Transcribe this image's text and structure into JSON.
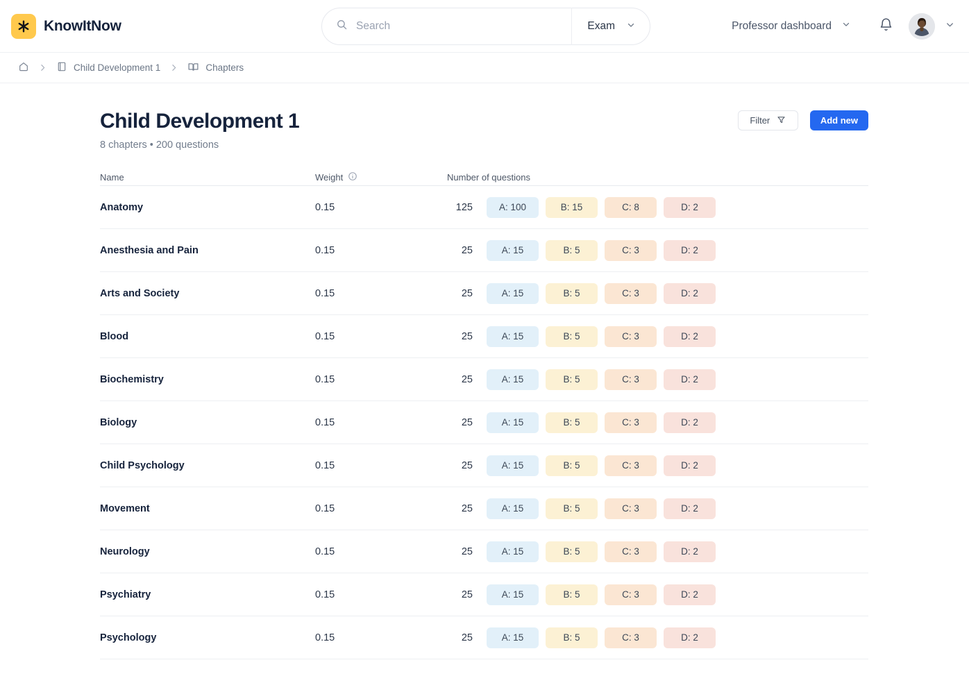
{
  "brand": {
    "name": "KnowItNow",
    "mark_icon": "asterisk-logo-icon",
    "mark_color": "#ffc94d"
  },
  "search": {
    "placeholder": "Search",
    "value": "",
    "icon": "search-icon",
    "scope_label": "Exam",
    "scope_caret_icon": "chevron-down-icon"
  },
  "header": {
    "dashboard_switcher": "Professor dashboard",
    "dashboard_caret_icon": "chevron-down-icon",
    "bell_icon": "bell-icon",
    "avatar_icon": "user-avatar",
    "avatar_caret_icon": "chevron-down-icon"
  },
  "breadcrumb": {
    "items": [
      {
        "label": "",
        "icon": "home-icon"
      },
      {
        "label": "Child Development 1",
        "icon": "book-icon"
      },
      {
        "label": "Chapters",
        "icon": "open-book-icon"
      }
    ],
    "separator_icon": "chevron-right-icon"
  },
  "page": {
    "title": "Child Development 1",
    "subtitle": "8 chapters  •  200 questions",
    "filter_label": "Filter",
    "filter_icon": "funnel-icon",
    "add_label": "Add new",
    "accent_color": "#2468f0"
  },
  "table": {
    "headers": {
      "name": "Name",
      "weight": "Weight",
      "weight_info_icon": "info-circle-icon",
      "questions": "Number of questions"
    },
    "badge_colors": {
      "A": "#e2f0f9",
      "B": "#fcf1d4",
      "C": "#fbe6d3",
      "D": "#f9e2dc"
    },
    "rows": [
      {
        "name": "Anatomy",
        "weight": "0.15",
        "total": "125",
        "badges": [
          {
            "key": "A",
            "label": "A: 100"
          },
          {
            "key": "B",
            "label": "B: 15"
          },
          {
            "key": "C",
            "label": "C: 8"
          },
          {
            "key": "D",
            "label": "D: 2"
          }
        ]
      },
      {
        "name": "Anesthesia and Pain",
        "weight": "0.15",
        "total": "25",
        "badges": [
          {
            "key": "A",
            "label": "A: 15"
          },
          {
            "key": "B",
            "label": "B: 5"
          },
          {
            "key": "C",
            "label": "C: 3"
          },
          {
            "key": "D",
            "label": "D: 2"
          }
        ]
      },
      {
        "name": "Arts and Society",
        "weight": "0.15",
        "total": "25",
        "badges": [
          {
            "key": "A",
            "label": "A: 15"
          },
          {
            "key": "B",
            "label": "B: 5"
          },
          {
            "key": "C",
            "label": "C: 3"
          },
          {
            "key": "D",
            "label": "D: 2"
          }
        ]
      },
      {
        "name": "Blood",
        "weight": "0.15",
        "total": "25",
        "badges": [
          {
            "key": "A",
            "label": "A: 15"
          },
          {
            "key": "B",
            "label": "B: 5"
          },
          {
            "key": "C",
            "label": "C: 3"
          },
          {
            "key": "D",
            "label": "D: 2"
          }
        ]
      },
      {
        "name": "Biochemistry",
        "weight": "0.15",
        "total": "25",
        "badges": [
          {
            "key": "A",
            "label": "A: 15"
          },
          {
            "key": "B",
            "label": "B: 5"
          },
          {
            "key": "C",
            "label": "C: 3"
          },
          {
            "key": "D",
            "label": "D: 2"
          }
        ]
      },
      {
        "name": "Biology",
        "weight": "0.15",
        "total": "25",
        "badges": [
          {
            "key": "A",
            "label": "A: 15"
          },
          {
            "key": "B",
            "label": "B: 5"
          },
          {
            "key": "C",
            "label": "C: 3"
          },
          {
            "key": "D",
            "label": "D: 2"
          }
        ]
      },
      {
        "name": "Child Psychology",
        "weight": "0.15",
        "total": "25",
        "badges": [
          {
            "key": "A",
            "label": "A: 15"
          },
          {
            "key": "B",
            "label": "B: 5"
          },
          {
            "key": "C",
            "label": "C: 3"
          },
          {
            "key": "D",
            "label": "D: 2"
          }
        ]
      },
      {
        "name": "Movement",
        "weight": "0.15",
        "total": "25",
        "badges": [
          {
            "key": "A",
            "label": "A: 15"
          },
          {
            "key": "B",
            "label": "B: 5"
          },
          {
            "key": "C",
            "label": "C: 3"
          },
          {
            "key": "D",
            "label": "D: 2"
          }
        ]
      },
      {
        "name": "Neurology",
        "weight": "0.15",
        "total": "25",
        "badges": [
          {
            "key": "A",
            "label": "A: 15"
          },
          {
            "key": "B",
            "label": "B: 5"
          },
          {
            "key": "C",
            "label": "C: 3"
          },
          {
            "key": "D",
            "label": "D: 2"
          }
        ]
      },
      {
        "name": "Psychiatry",
        "weight": "0.15",
        "total": "25",
        "badges": [
          {
            "key": "A",
            "label": "A: 15"
          },
          {
            "key": "B",
            "label": "B: 5"
          },
          {
            "key": "C",
            "label": "C: 3"
          },
          {
            "key": "D",
            "label": "D: 2"
          }
        ]
      },
      {
        "name": "Psychology",
        "weight": "0.15",
        "total": "25",
        "badges": [
          {
            "key": "A",
            "label": "A: 15"
          },
          {
            "key": "B",
            "label": "B: 5"
          },
          {
            "key": "C",
            "label": "C: 3"
          },
          {
            "key": "D",
            "label": "D: 2"
          }
        ]
      }
    ]
  }
}
